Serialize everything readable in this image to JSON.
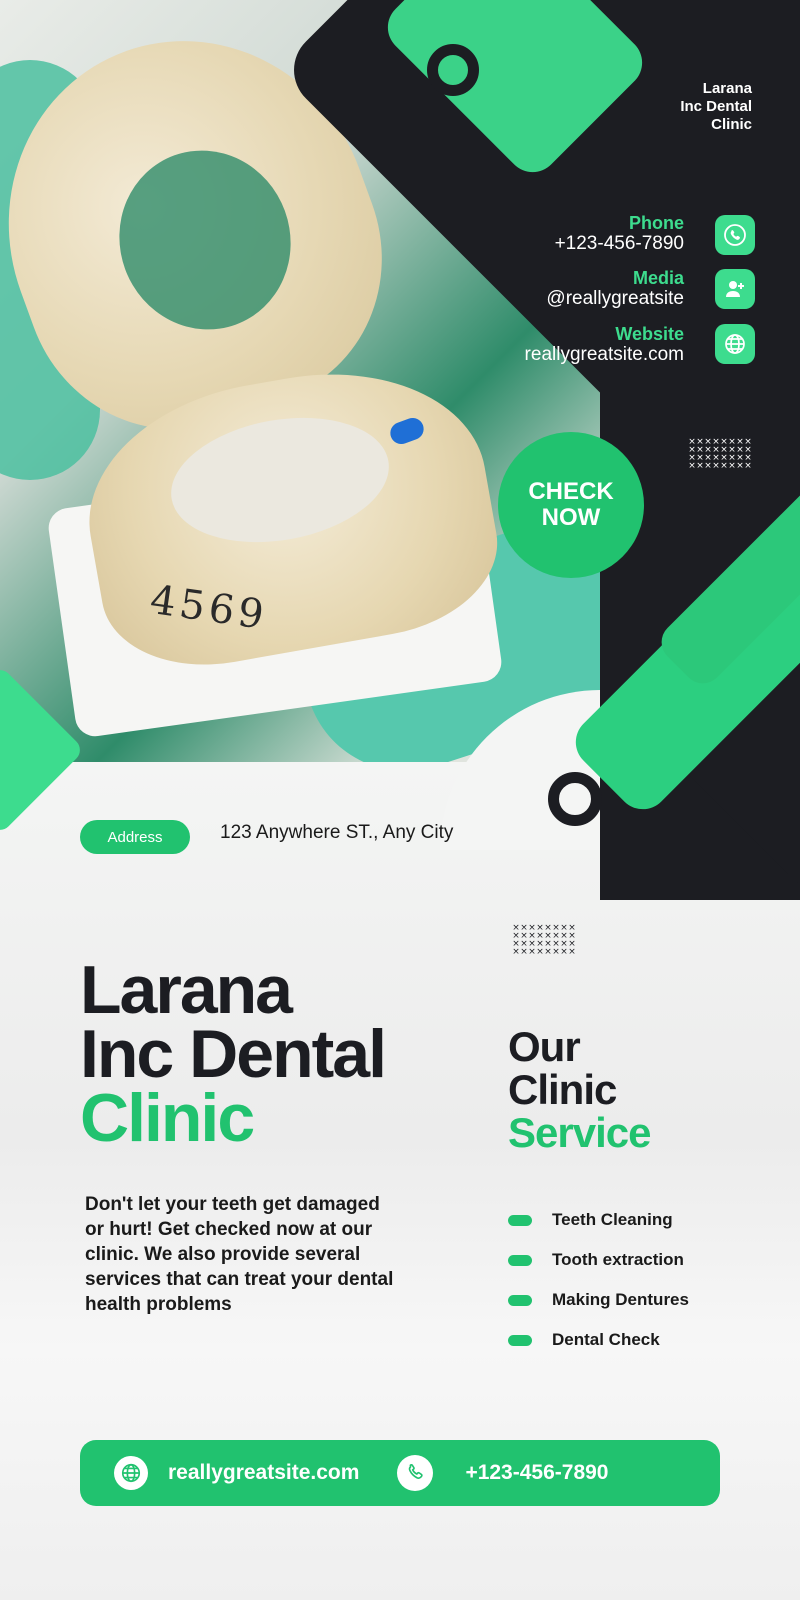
{
  "brand": {
    "name_lines": [
      "Larana",
      "Inc Dental",
      "Clinic"
    ],
    "title_lines": [
      "Larana",
      "Inc Dental"
    ],
    "title_accent": "Clinic"
  },
  "contacts": [
    {
      "label": "Phone",
      "value": "+123-456-7890",
      "icon": "phone-icon"
    },
    {
      "label": "Media",
      "value": "@reallygreatsite",
      "icon": "user-plus-icon"
    },
    {
      "label": "Website",
      "value": "reallygreatsite.com",
      "icon": "globe-icon"
    }
  ],
  "cta": {
    "line1": "CHECK",
    "line2": "NOW"
  },
  "address": {
    "badge": "Address",
    "text": "123 Anywhere ST., Any City"
  },
  "description": "Don't let your teeth get damaged or hurt! Get checked now at our clinic. We also provide several services that can treat your dental health problems",
  "services": {
    "title_lines": [
      "Our",
      "Clinic"
    ],
    "title_accent": "Service",
    "items": [
      "Teeth Cleaning",
      "Tooth extraction",
      "Making Dentures",
      "Dental Check"
    ]
  },
  "footer": {
    "website": "reallygreatsite.com",
    "phone": "+123-456-7890"
  },
  "photo": {
    "mold_number": "4569"
  },
  "colors": {
    "accent": "#21c26f",
    "accent_light": "#3ddc8e",
    "dark": "#1c1d22"
  }
}
